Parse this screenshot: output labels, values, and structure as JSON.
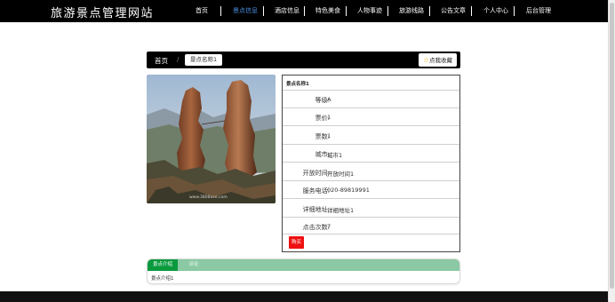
{
  "site": {
    "title": "旅游景点管理网站"
  },
  "nav": {
    "items": [
      {
        "label": "首页",
        "active": false
      },
      {
        "label": "景点信息",
        "active": true
      },
      {
        "label": "酒店信息",
        "active": false
      },
      {
        "label": "特色美食",
        "active": false
      },
      {
        "label": "人物事迹",
        "active": false
      },
      {
        "label": "旅游线路",
        "active": false
      },
      {
        "label": "公告文章",
        "active": false
      },
      {
        "label": "个人中心",
        "active": false
      },
      {
        "label": "后台管理",
        "active": false
      }
    ]
  },
  "breadcrumb": {
    "home": "首页",
    "separator": "/",
    "current": "景点名称1"
  },
  "favorite": {
    "label": "点我收藏",
    "icon": "star-icon"
  },
  "image": {
    "watermark": "www.3808ave.com"
  },
  "detail": {
    "title": "景点名称1",
    "rows": [
      {
        "label": "等级:",
        "value": "A"
      },
      {
        "label": "票价:",
        "value": "1"
      },
      {
        "label": "票数:",
        "value": "1"
      },
      {
        "label": "城市:",
        "value": "城市1"
      },
      {
        "label": "开放时间:",
        "value": "开放时间1"
      },
      {
        "label": "服务电话:",
        "value": "020-89819991"
      },
      {
        "label": "详细地址:",
        "value": "详细地址1"
      },
      {
        "label": "点击次数:",
        "value": "7"
      }
    ],
    "rate_label": "购买"
  },
  "tabs": {
    "items": [
      {
        "label": "景点介绍",
        "active": true
      },
      {
        "label": "评论",
        "active": false
      }
    ],
    "content": "景点介绍1"
  },
  "colors": {
    "nav_active": "#4a90e2",
    "tab_active": "#0a9a3e",
    "tab_header": "#8ac9a3",
    "button_red": "#ee1111",
    "star": "#f0b400"
  }
}
